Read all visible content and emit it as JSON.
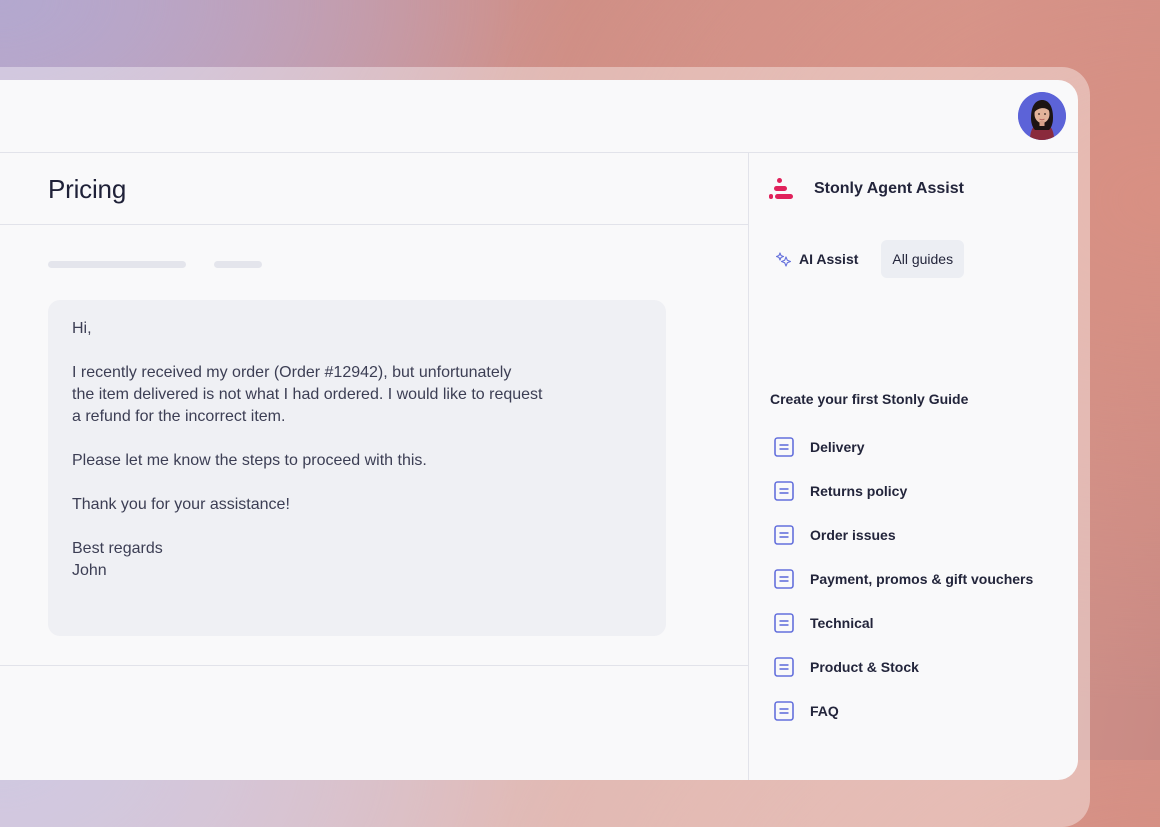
{
  "app": {
    "accent_color": "#e0225b",
    "icon_color": "#6470dc",
    "avatar": "user-avatar-photo"
  },
  "page": {
    "title": "Pricing"
  },
  "message": {
    "paragraphs": [
      "Hi,",
      "I recently received my order (Order #12942), but unfortunately\nthe item delivered is not what I had ordered. I would like to request\na refund for the incorrect item.",
      "Please let me know the steps to proceed with this.",
      "Thank you for your assistance!",
      "Best regards\nJohn"
    ]
  },
  "sidebar": {
    "brand_name": "Stonly Agent Assist",
    "tabs": [
      {
        "label": "AI Assist",
        "icon": "sparkle-icon",
        "active": false
      },
      {
        "label": "All guides",
        "active": true
      }
    ],
    "guides_heading": "Create your first Stonly Guide",
    "guides": [
      {
        "label": "Delivery",
        "icon": "document-icon"
      },
      {
        "label": "Returns policy",
        "icon": "document-icon"
      },
      {
        "label": "Order issues",
        "icon": "document-icon"
      },
      {
        "label": "Payment, promos & gift vouchers",
        "icon": "document-icon"
      },
      {
        "label": "Technical",
        "icon": "document-icon"
      },
      {
        "label": "Product & Stock",
        "icon": "document-icon"
      },
      {
        "label": "FAQ",
        "icon": "document-icon"
      }
    ]
  }
}
